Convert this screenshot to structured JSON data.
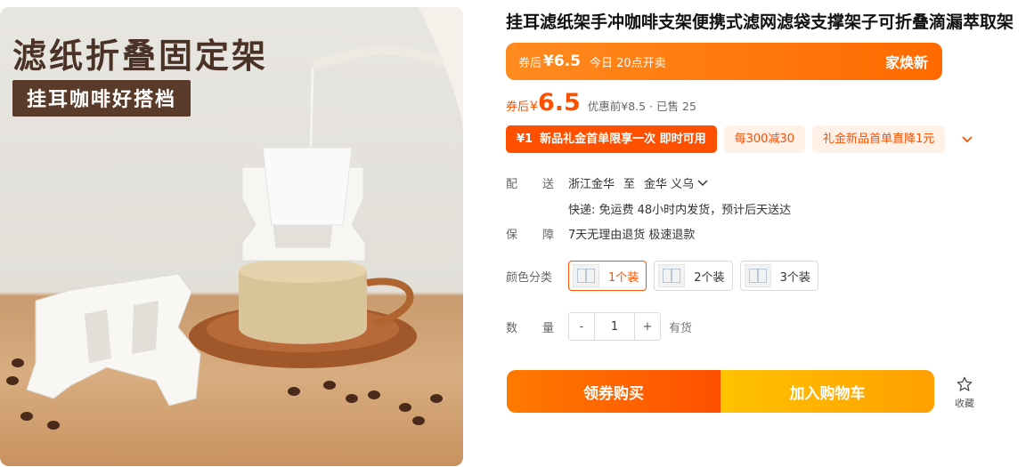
{
  "image": {
    "headline": "滤纸折叠固定架",
    "tag": "挂耳咖啡好搭档"
  },
  "product": {
    "title": "挂耳滤纸架手冲咖啡支架便携式滤网滤袋支撑架子可折叠滴漏萃取架"
  },
  "banner": {
    "coupon_label": "券后",
    "price": "¥6.5",
    "time_text": "今日 20点开卖",
    "badge": "家焕新"
  },
  "price": {
    "coupon_label": "券后",
    "currency": "¥",
    "value": "6.5",
    "original_text": "优惠前¥8.5 · 已售 25"
  },
  "coupons": {
    "main_amount": "¥1",
    "main_text": "新品礼金首单限享一次 即时可用",
    "items": [
      "每300减30",
      "礼金新品首单直降1元"
    ],
    "expand_icon": "chevron-down-icon"
  },
  "delivery": {
    "label_a": "配",
    "label_b": "送",
    "from": "浙江金华",
    "to_word": "至",
    "to": "金华 义乌",
    "shipping": "快递: 免运费   48小时内发货，预计后天送达"
  },
  "guarantee": {
    "label_a": "保",
    "label_b": "障",
    "text": "7天无理由退货 极速退款"
  },
  "sku": {
    "label": "颜色分类",
    "options": [
      "1个装",
      "2个装",
      "3个装"
    ],
    "selected": 0
  },
  "quantity": {
    "label_a": "数",
    "label_b": "量",
    "minus": "-",
    "value": "1",
    "plus": "+",
    "stock": "有货"
  },
  "actions": {
    "buy": "领券购买",
    "cart": "加入购物车",
    "favorite": "收藏"
  },
  "colors": {
    "accent": "#ff5000",
    "banner": "#ff7a00",
    "cart": "#ffb300"
  }
}
